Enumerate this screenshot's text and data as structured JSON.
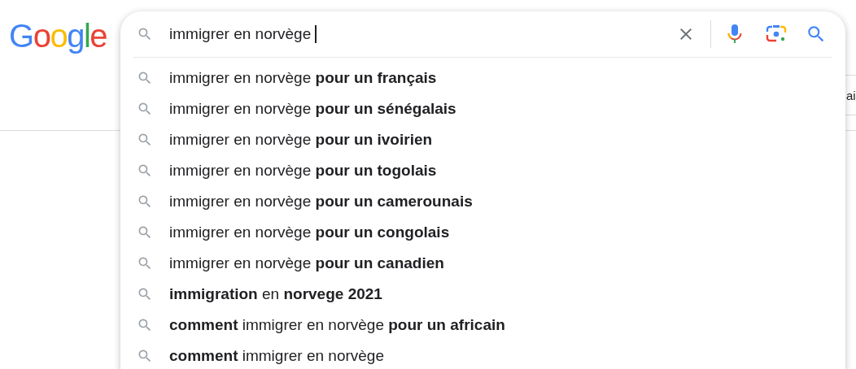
{
  "logo": "Google",
  "search": {
    "value": "immigrer en norvège"
  },
  "suggestions": [
    {
      "text": "immigrer en norvège **pour un français**"
    },
    {
      "text": "immigrer en norvège **pour un sénégalais**"
    },
    {
      "text": "immigrer en norvège **pour un ivoirien**"
    },
    {
      "text": "immigrer en norvège **pour un togolais**"
    },
    {
      "text": "immigrer en norvège **pour un camerounais**"
    },
    {
      "text": "immigrer en norvège **pour un congolais**"
    },
    {
      "text": "immigrer en norvège **pour un canadien**"
    },
    {
      "text": "**immigration** en **norvege 2021**"
    },
    {
      "text": "**comment** immigrer en norvège **pour un africain**"
    },
    {
      "text": "**comment** immigrer en norvège"
    }
  ],
  "background_tab": {
    "label": "ai"
  }
}
